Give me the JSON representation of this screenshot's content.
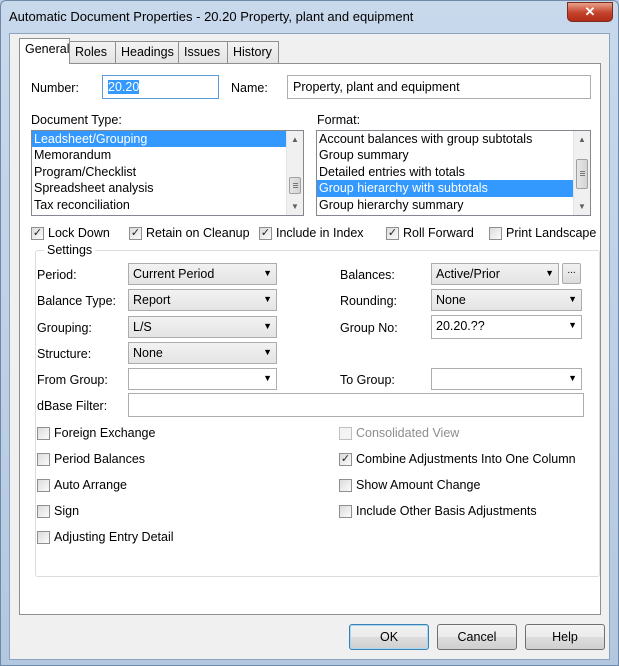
{
  "window": {
    "title": "Automatic Document Properties - 20.20 Property, plant and equipment",
    "close_label": "✕"
  },
  "tabs": [
    "General",
    "Roles",
    "Headings",
    "Issues",
    "History"
  ],
  "general": {
    "number_label": "Number:",
    "number_value": "20.20",
    "name_label": "Name:",
    "name_value": "Property, plant and equipment",
    "doc_type_label": "Document Type:",
    "doc_types": [
      "Leadsheet/Grouping",
      "Memorandum",
      "Program/Checklist",
      "Spreadsheet analysis",
      "Tax reconciliation"
    ],
    "doc_type_selected": "Leadsheet/Grouping",
    "format_label": "Format:",
    "formats": [
      "Account balances with group subtotals",
      "Group summary",
      "Detailed entries with totals",
      "Group hierarchy with subtotals",
      "Group hierarchy summary"
    ],
    "format_selected": "Group hierarchy with subtotals",
    "options": [
      {
        "label": "Lock Down",
        "checked": true
      },
      {
        "label": "Retain on Cleanup",
        "checked": true
      },
      {
        "label": "Include in Index",
        "checked": true
      },
      {
        "label": "Roll Forward",
        "checked": true
      },
      {
        "label": "Print Landscape",
        "checked": false
      }
    ]
  },
  "settings": {
    "legend": "Settings",
    "period_label": "Period:",
    "period_value": "Current Period",
    "balance_type_label": "Balance Type:",
    "balance_type_value": "Report",
    "grouping_label": "Grouping:",
    "grouping_value": "L/S",
    "structure_label": "Structure:",
    "structure_value": "None",
    "from_group_label": "From Group:",
    "from_group_value": "",
    "dbase_filter_label": "dBase Filter:",
    "dbase_filter_value": "",
    "balances_label": "Balances:",
    "balances_value": "Active/Prior",
    "balances_more": "...",
    "rounding_label": "Rounding:",
    "rounding_value": "None",
    "group_no_label": "Group No:",
    "group_no_value": "20.20.??",
    "to_group_label": "To Group:",
    "to_group_value": "",
    "checks_left": [
      {
        "label": "Foreign Exchange",
        "checked": false
      },
      {
        "label": "Period Balances",
        "checked": false
      },
      {
        "label": "Auto Arrange",
        "checked": false
      },
      {
        "label": "Sign",
        "checked": false
      },
      {
        "label": "Adjusting Entry Detail",
        "checked": false
      }
    ],
    "checks_right": [
      {
        "label": "Consolidated View",
        "checked": false,
        "disabled": true
      },
      {
        "label": "Combine Adjustments Into One Column",
        "checked": true
      },
      {
        "label": "Show Amount Change",
        "checked": false
      },
      {
        "label": "Include Other Basis Adjustments",
        "checked": false
      }
    ]
  },
  "buttons": {
    "ok": "OK",
    "cancel": "Cancel",
    "help": "Help"
  },
  "symbols": {
    "check": "✓",
    "unchecked": "",
    "arrow_down": "▼",
    "arrow_up": "▲"
  }
}
